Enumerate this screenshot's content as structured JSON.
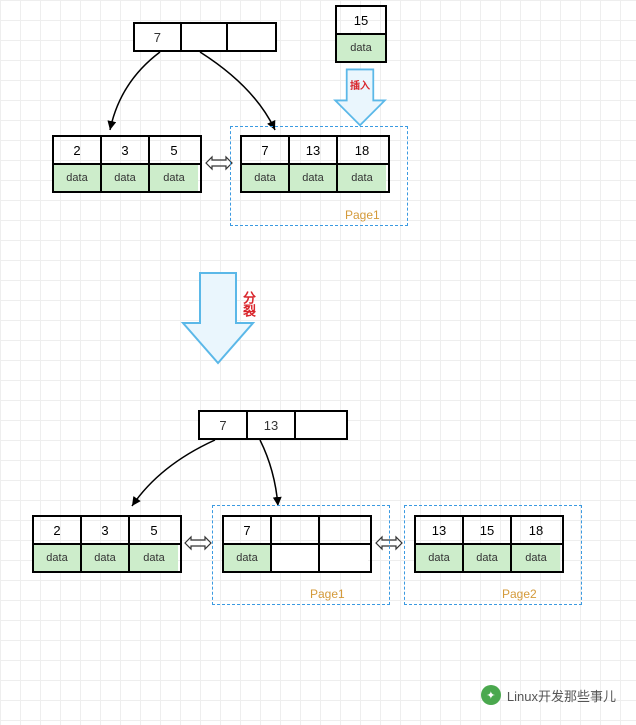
{
  "top": {
    "insert_node": {
      "key": "15",
      "data": "data"
    },
    "root": {
      "keys": [
        "7",
        "",
        ""
      ]
    },
    "leaf_left": {
      "keys": [
        "2",
        "3",
        "5"
      ],
      "data": [
        "data",
        "data",
        "data"
      ]
    },
    "leaf_right": {
      "keys": [
        "7",
        "13",
        "18"
      ],
      "data": [
        "data",
        "data",
        "data"
      ]
    },
    "page_label": "Page1",
    "op_label": "插入"
  },
  "mid": {
    "op_label": "分裂"
  },
  "bottom": {
    "root": {
      "keys": [
        "7",
        "13",
        ""
      ]
    },
    "leaf_left": {
      "keys": [
        "2",
        "3",
        "5"
      ],
      "data": [
        "data",
        "data",
        "data"
      ]
    },
    "leaf_mid": {
      "keys": [
        "7",
        "",
        ""
      ],
      "data": [
        "data",
        "",
        ""
      ]
    },
    "leaf_right": {
      "keys": [
        "13",
        "15",
        "18"
      ],
      "data": [
        "data",
        "data",
        "data"
      ]
    },
    "page1_label": "Page1",
    "page2_label": "Page2"
  },
  "watermark": "Linux开发那些事儿"
}
